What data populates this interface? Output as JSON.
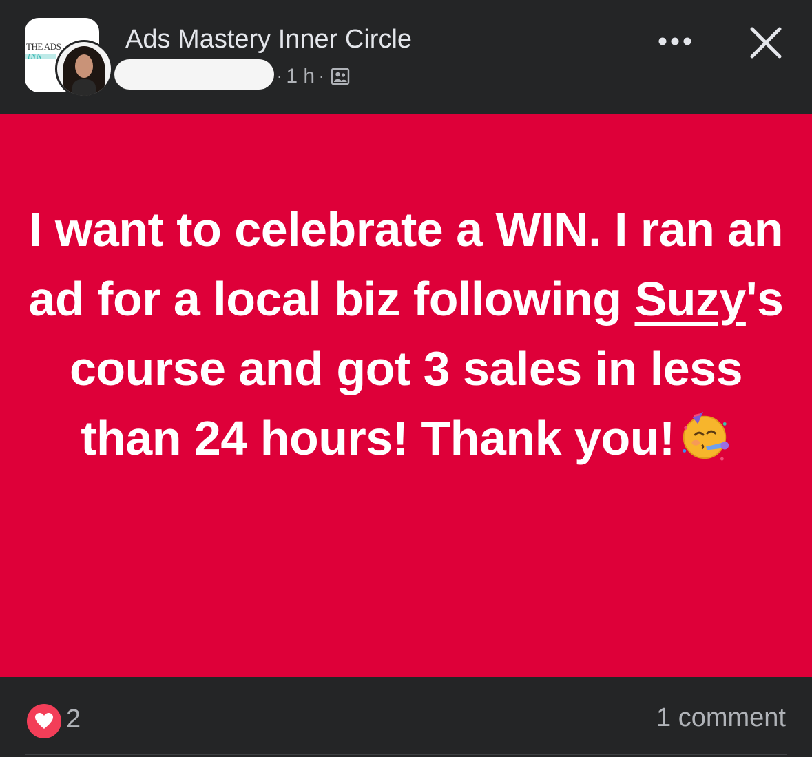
{
  "header": {
    "group_name": "Ads Mastery Inner Circle",
    "time_ago": "1 h",
    "separator": "·",
    "logo_text_line1": "THE ADS",
    "logo_text_line2": "INN",
    "audience_icon": "group-members-icon",
    "more_icon": "more-options-icon",
    "close_icon": "close-icon"
  },
  "post": {
    "background_color": "#de0039",
    "text_before_mention": "I want to celebrate a WIN. I ran an ad for a local biz following ",
    "mention": "Suzy",
    "text_after_mention": "'s course and got 3 sales in less than 24 hours! Thank you!",
    "emoji": "partying-face-emoji"
  },
  "footer": {
    "reaction_icon": "love-reaction-icon",
    "reaction_count": "2",
    "comment_count_label": "1 comment"
  }
}
